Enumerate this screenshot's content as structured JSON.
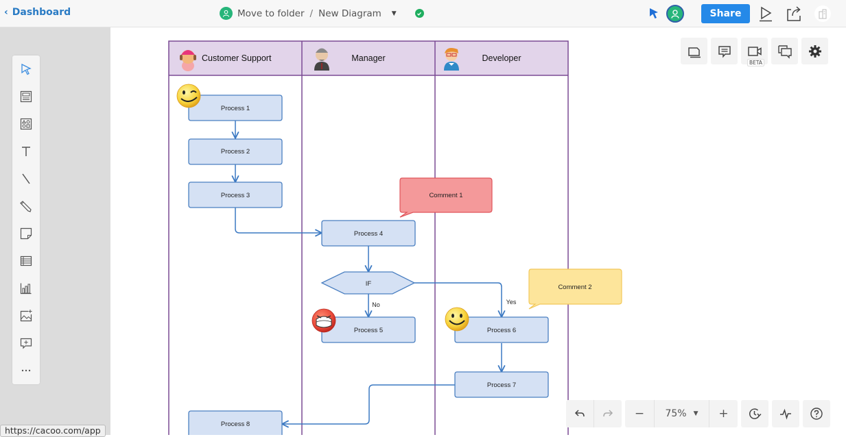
{
  "topbar": {
    "back_label": "Dashboard",
    "folder_label": "Move to folder",
    "separator": "/",
    "diagram_name": "New Diagram",
    "share_label": "Share",
    "colors": {
      "accent": "#2589e8",
      "link": "#2a7bc4",
      "avatar": "#26b57a"
    }
  },
  "toolbar": {
    "items": [
      {
        "name": "select",
        "icon": "cursor-arrow-icon"
      },
      {
        "name": "template",
        "icon": "template-icon"
      },
      {
        "name": "shapes",
        "icon": "shapes-icon"
      },
      {
        "name": "text",
        "icon": "text-icon"
      },
      {
        "name": "line",
        "icon": "line-icon"
      },
      {
        "name": "pencil",
        "icon": "pencil-icon"
      },
      {
        "name": "sticky-note",
        "icon": "sticky-note-icon"
      },
      {
        "name": "table",
        "icon": "table-icon"
      },
      {
        "name": "chart",
        "icon": "chart-icon"
      },
      {
        "name": "image",
        "icon": "image-add-icon"
      },
      {
        "name": "comment",
        "icon": "comment-add-icon"
      },
      {
        "name": "more",
        "icon": "more-icon"
      }
    ]
  },
  "right_panel": {
    "items": [
      {
        "name": "pages",
        "icon": "pages-icon"
      },
      {
        "name": "comments",
        "icon": "comment-icon"
      },
      {
        "name": "video",
        "icon": "video-icon",
        "badge": "BETA"
      },
      {
        "name": "chat",
        "icon": "chat-icon"
      },
      {
        "name": "settings",
        "icon": "gear-icon"
      }
    ]
  },
  "bottom_bar": {
    "zoom_level": "75%",
    "minus": "−",
    "plus": "+"
  },
  "status_url": "https://cacoo.com/app",
  "diagram": {
    "lanes": [
      {
        "title": "Customer Support",
        "avatar": "support-agent-avatar"
      },
      {
        "title": "Manager",
        "avatar": "manager-avatar"
      },
      {
        "title": "Developer",
        "avatar": "developer-avatar"
      }
    ],
    "processes": [
      "Process 1",
      "Process 2",
      "Process 3",
      "Process 4",
      "Process 5",
      "Process 6",
      "Process 7",
      "Process 8"
    ],
    "decision": "IF",
    "branch_no": "No",
    "branch_yes": "Yes",
    "comments": [
      {
        "text": "Comment 1",
        "color": "#f4999a"
      },
      {
        "text": "Comment 2",
        "color": "#fde59b"
      }
    ],
    "colors": {
      "lane_header": "#e2d4ea",
      "lane_border": "#7a4a94",
      "process_fill": "#d5e1f4",
      "process_border": "#4a7fc1",
      "connector": "#3a78c2"
    }
  }
}
